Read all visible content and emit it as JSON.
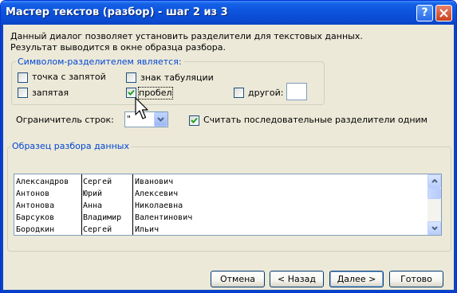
{
  "window": {
    "title": "Мастер текстов (разбор) - шаг 2 из 3",
    "help_label": "?"
  },
  "description": {
    "line1": "Данный диалог позволяет установить разделители для текстовых данных.",
    "line2": "Результат выводится в окне образца разбора."
  },
  "delimiters": {
    "group_label": "Символом-разделителем является:",
    "tab": {
      "label": "знак табуляции",
      "checked": false
    },
    "semicolon": {
      "label": "точка с запятой",
      "checked": false
    },
    "comma": {
      "label": "запятая",
      "checked": false
    },
    "space": {
      "label": "пробел",
      "checked": true
    },
    "other": {
      "label": "другой:",
      "checked": false,
      "value": ""
    }
  },
  "text_qualifier": {
    "label": "Ограничитель строк:",
    "value": "\""
  },
  "consecutive": {
    "label": "Считать последовательные разделители одним",
    "checked": true
  },
  "preview": {
    "group_label": "Образец разбора данных",
    "rows": [
      [
        "Александров",
        "Сергей",
        "Иванович"
      ],
      [
        "Антонов",
        "Юрий",
        "Алексевич"
      ],
      [
        "Антонова",
        "Анна",
        "Николаевна"
      ],
      [
        "Барсуков",
        "Владимир",
        "Валентинович"
      ],
      [
        "Бородкин",
        "Сергей",
        "Ильич"
      ]
    ]
  },
  "buttons": {
    "cancel": "Отмена",
    "back": "< Назад",
    "next": "Далее >",
    "finish": "Готово"
  },
  "colors": {
    "title_bar": "#0a4ad0",
    "dialog_bg": "#ece9d8",
    "group_label": "#0046d5",
    "check_mark": "#21a121"
  }
}
